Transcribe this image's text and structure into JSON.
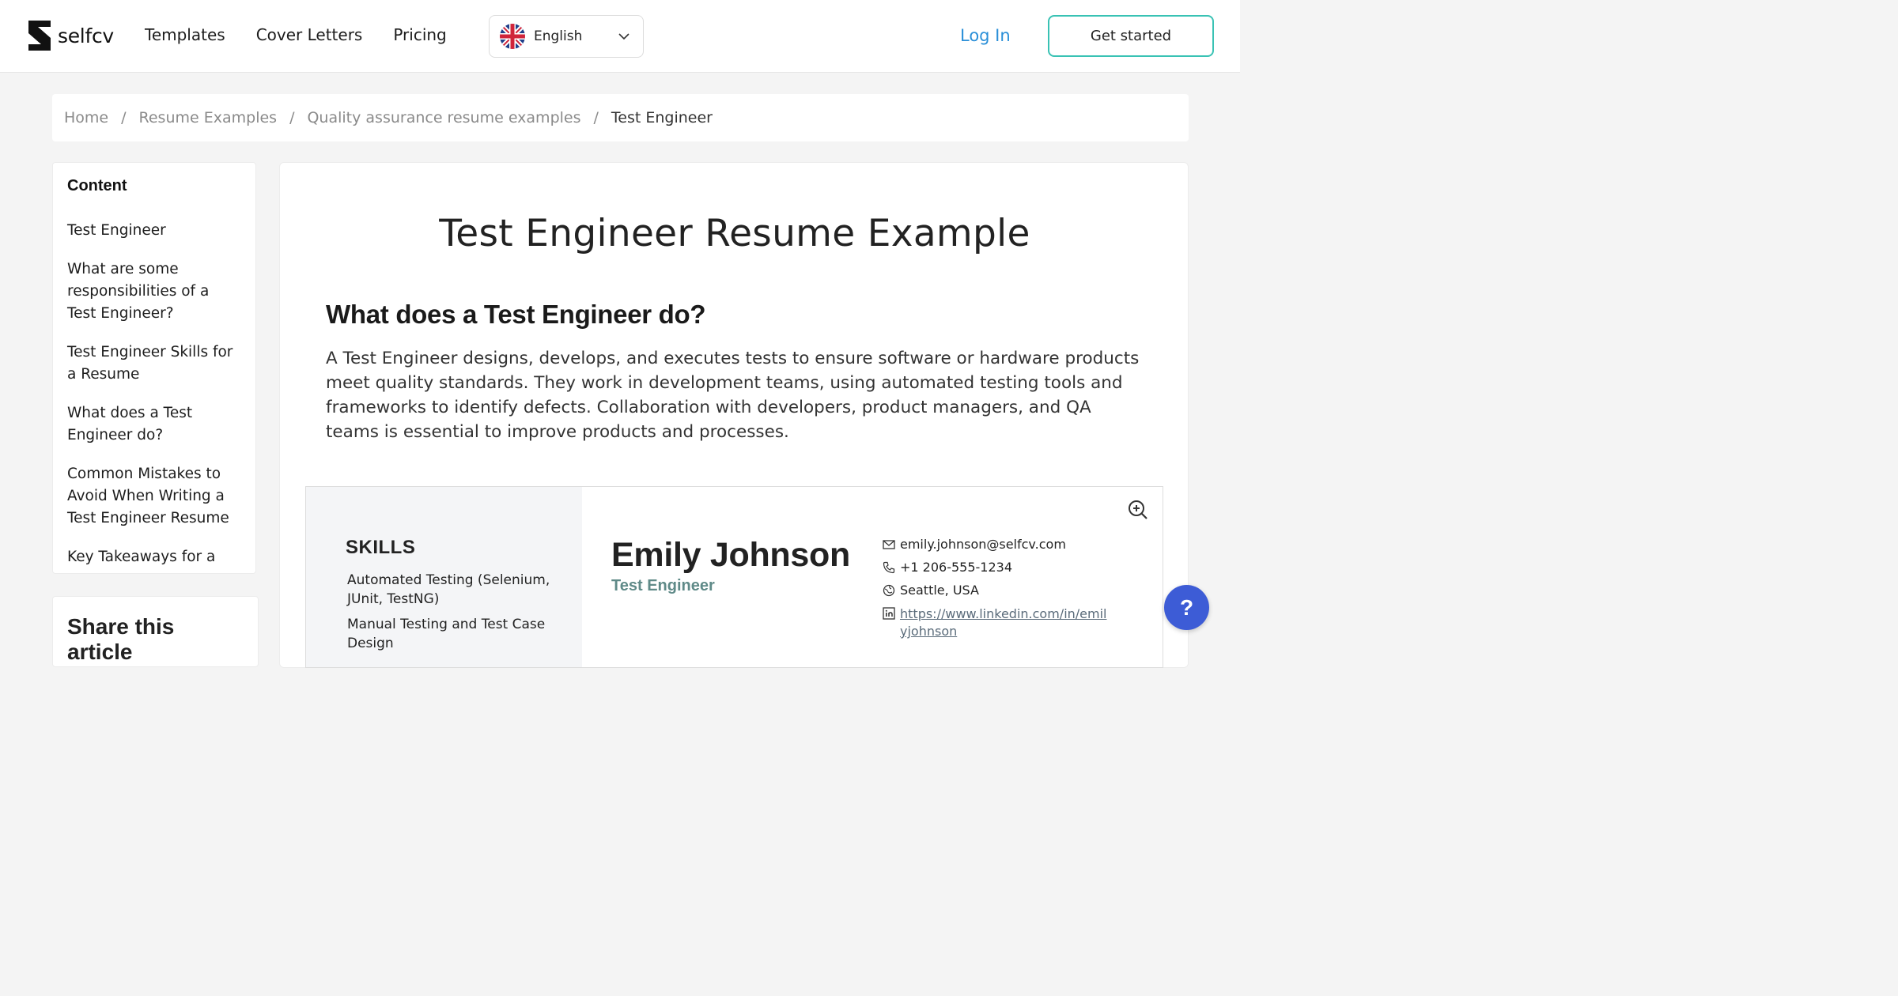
{
  "header": {
    "logo_text": "selfcv",
    "nav": [
      "Templates",
      "Cover Letters",
      "Pricing"
    ],
    "language": "English",
    "login_label": "Log In",
    "cta_label": "Get started",
    "accent_color": "#39c2b4",
    "link_color": "#2a8fd8"
  },
  "breadcrumb": [
    "Home",
    "Resume Examples",
    "Quality assurance resume examples",
    "Test Engineer"
  ],
  "toc": {
    "title": "Content",
    "items": [
      "Test Engineer",
      "What are some responsibilities of a Test Engineer?",
      "Test Engineer Skills for a Resume",
      "What does a Test Engineer do?",
      "Common Mistakes to Avoid When Writing a Test Engineer Resume",
      "Key Takeaways for a"
    ]
  },
  "share": {
    "title": "Share this article"
  },
  "main": {
    "title": "Test Engineer Resume Example",
    "section_heading": "What does a Test Engineer do?",
    "section_body": "A Test Engineer designs, develops, and executes tests to ensure software or hardware products meet quality standards. They work in development teams, using automated testing tools and frameworks to identify defects. Collaboration with developers, product managers, and QA teams is essential to improve products and processes."
  },
  "resume": {
    "skills_title": "SKILLS",
    "skills": [
      "Automated Testing (Selenium, JUnit, TestNG)",
      "Manual Testing and Test Case Design"
    ],
    "name": "Emily Johnson",
    "role": "Test Engineer",
    "email": "emily.johnson@selfcv.com",
    "phone": "+1 206-555-1234",
    "location": "Seattle, USA",
    "linkedin": "https://www.linkedin.com/in/emilyjohnson"
  },
  "help_label": "?"
}
